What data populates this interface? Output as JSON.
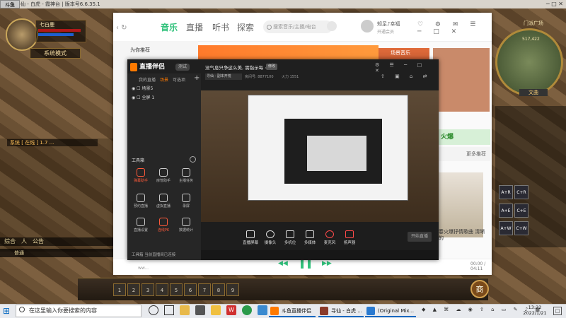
{
  "game": {
    "window_title": "寻仙 - 白虎 - 霞神台 | 版本号6.6.35.1",
    "overlay_logo": "斗鱼",
    "char_name": "七白鹿",
    "mode_label": "系统模式",
    "chat_tab_system": "系统",
    "chat_line": "[ 在线 ] 1.7 ...",
    "chat_tabs": [
      "综合",
      "人",
      "公告"
    ],
    "chat_input_label": "普通",
    "map_name": "门派广场",
    "map_coords": "517,422",
    "right_btn": "文曲",
    "skills_row1": [
      "A+R",
      "C+R"
    ],
    "skills_row2": [
      "A+E",
      "C+E"
    ],
    "skills_row3": [
      "A+W",
      "C+W"
    ],
    "hotkeys": [
      "1",
      "2",
      "3",
      "4",
      "5",
      "6",
      "7",
      "8",
      "9"
    ],
    "shop_label": "商"
  },
  "music": {
    "tabs": [
      "音乐",
      "直播",
      "听书",
      "探索"
    ],
    "search_placeholder": "搜索音乐/主播/电台",
    "username": "知足♪幸福",
    "vip_badge": "开通会员",
    "sidebar_first": "为你推荐",
    "banner_card_title": "场景音乐",
    "hot_card": "火爆",
    "hot_card2": "更多推荐",
    "artist_caption": "春火爆抒情歌曲 清晰的",
    "player_time": "00:00 / 04:11",
    "player_user": "ww...",
    "accent_color": "#31c27c"
  },
  "live": {
    "app_name": "直播伴侣",
    "version": "测试",
    "left_tabs": [
      "我的直播",
      "场景",
      "可选项"
    ],
    "scenes": [
      "场景5",
      "全屏 1"
    ],
    "tools_label": "工具箱",
    "tools": [
      {
        "label": "弹幕助手",
        "active": true
      },
      {
        "label": "房管助手",
        "active": false
      },
      {
        "label": "主播任务",
        "active": false
      },
      {
        "label": "预约直播",
        "active": false
      },
      {
        "label": "虚拟直播",
        "active": false
      },
      {
        "label": "录屏",
        "active": false
      },
      {
        "label": "直播设置",
        "active": false
      },
      {
        "label": "连线PK",
        "active": true
      },
      {
        "label": "数据统计",
        "active": false
      }
    ],
    "status_left": "工具箱 当前直播间已连接",
    "title": "没气息只争这么美, 需指示每 ~",
    "edit_btn": "修改",
    "tag": "寻仙 · 副本开荒",
    "room_no": "房间号: 8877100",
    "fire": "火力 1551",
    "toolbar_buttons": [
      "直播屏幕",
      "摄像头",
      "多机位",
      "多媒体",
      "麦克风",
      "扬声器"
    ],
    "start_live": "开始直播",
    "accent_color": "#ff7a00"
  },
  "taskbar": {
    "search_placeholder": "在这里输入你要搜索的内容",
    "apps": [
      {
        "label": "斗鱼直播伴侣",
        "color": "#ff7a00"
      },
      {
        "label": "寻仙 - 白虎 ...",
        "color": "#8a3a2a"
      },
      {
        "label": "(Original Mix...",
        "color": "#2a7ad0"
      }
    ],
    "time": "13:22",
    "date": "2022/1/21",
    "notify": "□"
  }
}
